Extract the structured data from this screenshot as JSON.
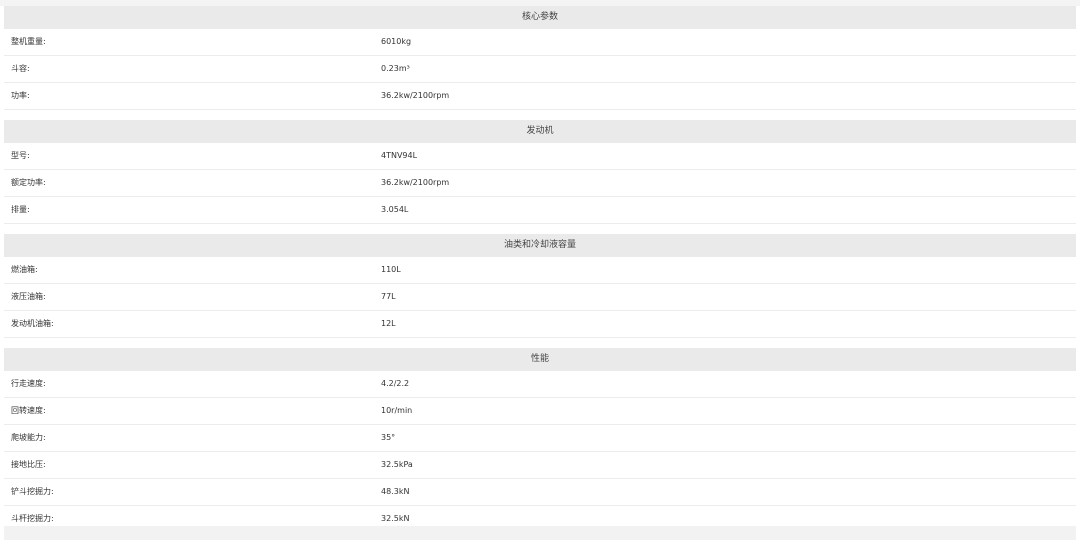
{
  "sections": [
    {
      "title": "核心参数",
      "rows": [
        {
          "label": "整机重量:",
          "value": "6010kg"
        },
        {
          "label": "斗容:",
          "value": "0.23m³"
        },
        {
          "label": "功率:",
          "value": "36.2kw/2100rpm"
        }
      ]
    },
    {
      "title": "发动机",
      "rows": [
        {
          "label": "型号:",
          "value": "4TNV94L"
        },
        {
          "label": "额定功率:",
          "value": "36.2kw/2100rpm"
        },
        {
          "label": "排量:",
          "value": "3.054L"
        }
      ]
    },
    {
      "title": "油类和冷却液容量",
      "rows": [
        {
          "label": "燃油箱:",
          "value": "110L"
        },
        {
          "label": "液压油箱:",
          "value": "77L"
        },
        {
          "label": "发动机油箱:",
          "value": "12L"
        }
      ]
    },
    {
      "title": "性能",
      "rows": [
        {
          "label": "行走速度:",
          "value": "4.2/2.2"
        },
        {
          "label": "回转速度:",
          "value": "10r/min"
        },
        {
          "label": "爬坡能力:",
          "value": "35°"
        },
        {
          "label": "接地比压:",
          "value": "32.5kPa"
        },
        {
          "label": "铲斗挖掘力:",
          "value": "48.3kN"
        },
        {
          "label": "斗杆挖掘力:",
          "value": "32.5kN"
        }
      ]
    }
  ]
}
